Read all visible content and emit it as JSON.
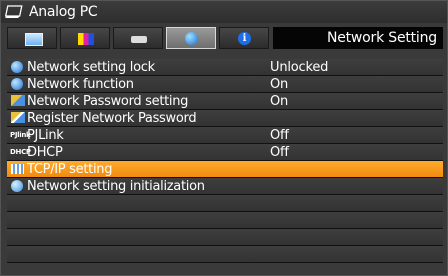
{
  "window": {
    "source": "Analog PC"
  },
  "tabs": [
    {
      "id": "picture-icon",
      "active": false
    },
    {
      "id": "color-bars-icon",
      "active": false
    },
    {
      "id": "projector-icon",
      "active": false
    },
    {
      "id": "network-globe-icon",
      "active": true
    },
    {
      "id": "info-icon",
      "active": false
    }
  ],
  "tab_title": "Network Setting",
  "items": [
    {
      "icon": "network-lock-icon",
      "label": "Network setting lock",
      "value": "Unlocked",
      "selected": false
    },
    {
      "icon": "network-function-icon",
      "label": "Network function",
      "value": "On",
      "selected": false
    },
    {
      "icon": "password-icon",
      "label": "Network Password setting",
      "value": "On",
      "selected": false
    },
    {
      "icon": "register-icon",
      "label": "Register Network Password",
      "value": "",
      "selected": false
    },
    {
      "icon": "pjlink-icon",
      "icon_text": "PJlink",
      "label": "PJLink",
      "value": "Off",
      "selected": false
    },
    {
      "icon": "dhcp-icon",
      "icon_text": "DHCP",
      "label": "DHCP",
      "value": "Off",
      "selected": false
    },
    {
      "icon": "tcpip-icon",
      "label": "TCP/IP setting",
      "value": "",
      "selected": true
    },
    {
      "icon": "init-icon",
      "label": "Network setting initialization",
      "value": "",
      "selected": false
    },
    {
      "label": "",
      "value": ""
    },
    {
      "label": "",
      "value": ""
    },
    {
      "label": "",
      "value": ""
    },
    {
      "label": "",
      "value": ""
    }
  ]
}
